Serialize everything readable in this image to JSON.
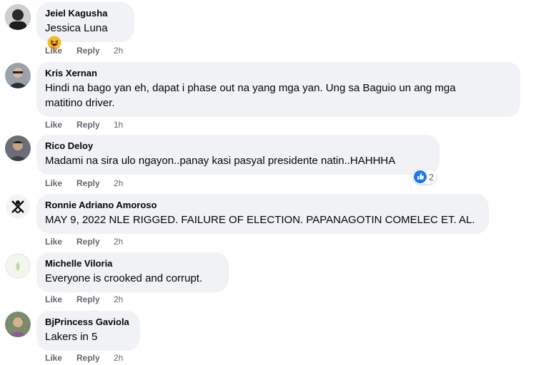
{
  "actions": {
    "like": "Like",
    "reply": "Reply"
  },
  "comments": [
    {
      "author": "Jeiel Kagusha",
      "text": "Jessica Luna",
      "emoji": "laughing-emoji",
      "time": "2h"
    },
    {
      "author": "Kris Xernan",
      "text_lines": [
        "Hindi na bago yan eh, dapat i phase out na yang mga yan. Ung sa Baguio un ang mga",
        "matitino driver."
      ],
      "time": "1h"
    },
    {
      "author": "Rico Deloy",
      "text": "Madami na sira ulo ngayon..panay kasi pasyal presidente natin..HAHHHA",
      "time": "2h",
      "reaction": {
        "icon": "like-reaction-icon",
        "count": "2",
        "color": "#1877f2"
      }
    },
    {
      "author": "Ronnie Adriano Amoroso",
      "text": "MAY 9, 2022 NLE RIGGED. FAILURE OF ELECTION. PAPANAGOTIN COMELEC ET. AL.",
      "time": "2h"
    },
    {
      "author": "Michelle Viloria",
      "text": "Everyone is crooked and corrupt.",
      "time": "2h"
    },
    {
      "author": "BjPrincess Gaviola",
      "text": "Lakers in 5",
      "time": "2h"
    }
  ]
}
